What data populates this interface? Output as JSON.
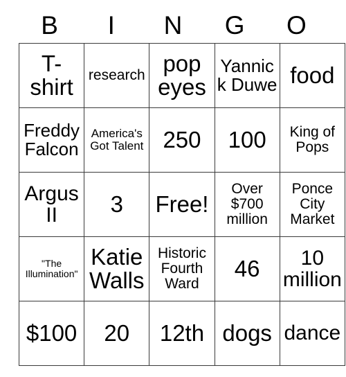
{
  "card": {
    "headers": [
      "B",
      "I",
      "N",
      "G",
      "O"
    ],
    "rows": [
      [
        {
          "text": "T-shirt",
          "size": "fs-xxl"
        },
        {
          "text": "research",
          "size": "fs-md"
        },
        {
          "text": "pop eyes",
          "size": "fs-xxl"
        },
        {
          "text": "Yannick Duwe",
          "size": "fs-lg"
        },
        {
          "text": "food",
          "size": "fs-xxl"
        }
      ],
      [
        {
          "text": "Freddy Falcon",
          "size": "fs-lg"
        },
        {
          "text": "America's Got Talent",
          "size": "fs-sm"
        },
        {
          "text": "250",
          "size": "fs-xxl"
        },
        {
          "text": "100",
          "size": "fs-xxl"
        },
        {
          "text": "King of Pops",
          "size": "fs-md"
        }
      ],
      [
        {
          "text": "Argus II",
          "size": "fs-xl"
        },
        {
          "text": "3",
          "size": "fs-xxl"
        },
        {
          "text": "Free!",
          "size": "fs-xxl"
        },
        {
          "text": "Over $700 million",
          "size": "fs-md"
        },
        {
          "text": "Ponce City Market",
          "size": "fs-md"
        }
      ],
      [
        {
          "text": "\"The Illumination\"",
          "size": "fs-xs"
        },
        {
          "text": "Katie Walls",
          "size": "fs-xxl"
        },
        {
          "text": "Historic Fourth Ward",
          "size": "fs-md"
        },
        {
          "text": "46",
          "size": "fs-xxl"
        },
        {
          "text": "10 million",
          "size": "fs-xl"
        }
      ],
      [
        {
          "text": "$100",
          "size": "fs-xxl"
        },
        {
          "text": "20",
          "size": "fs-xxl"
        },
        {
          "text": "12th",
          "size": "fs-xxl"
        },
        {
          "text": "dogs",
          "size": "fs-xxl"
        },
        {
          "text": "dance",
          "size": "fs-xl"
        }
      ]
    ],
    "free_space_label": "Free!",
    "colors": {
      "text": "#000000",
      "border": "#3a3a3a",
      "background": "#ffffff"
    }
  }
}
